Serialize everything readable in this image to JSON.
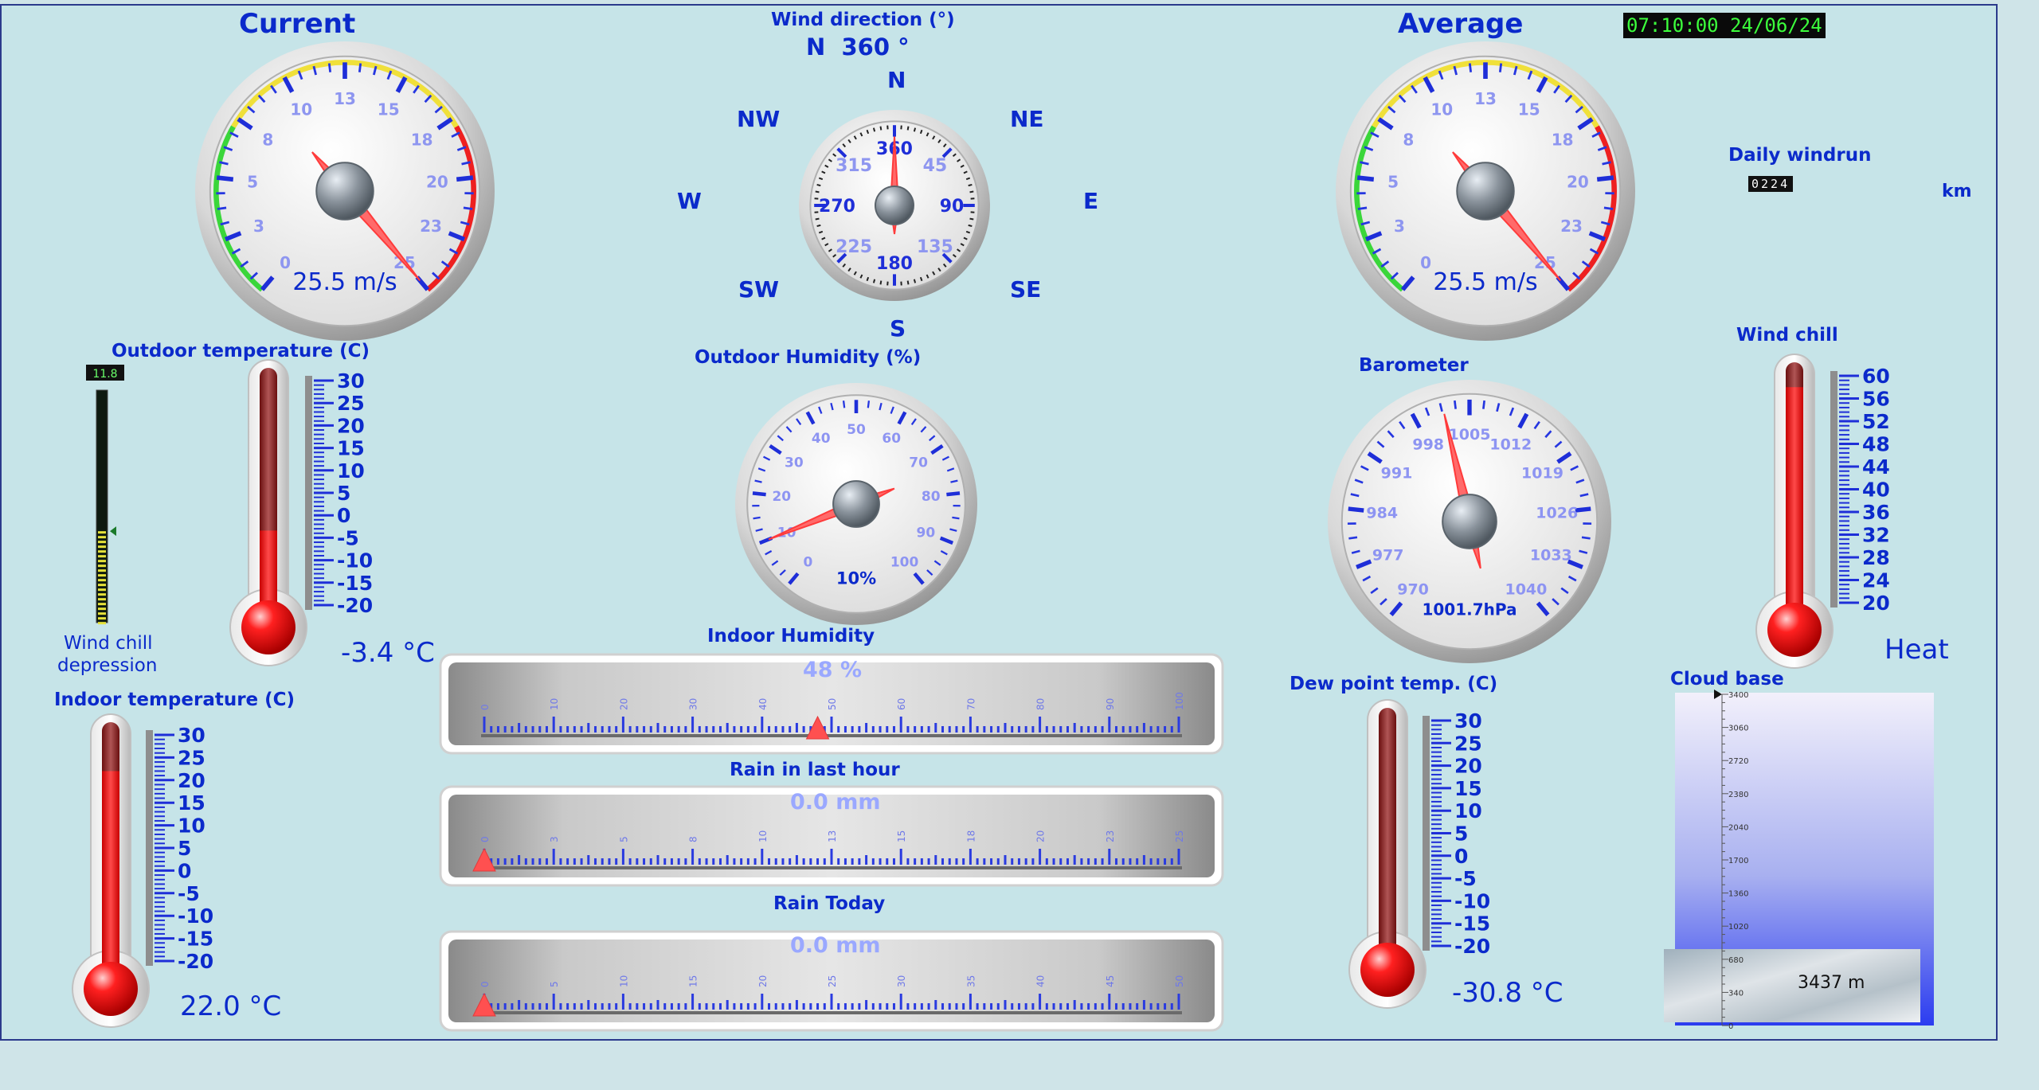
{
  "header": {
    "current_title": "Current",
    "average_title": "Average",
    "datetime": "07:10:00 24/06/24"
  },
  "wind_direction": {
    "title": "Wind direction (°)",
    "readout": "N  360 °",
    "value_deg": 360,
    "compass": {
      "n": "N",
      "ne": "NE",
      "e": "E",
      "se": "SE",
      "s": "S",
      "sw": "SW",
      "w": "W",
      "nw": "NW"
    },
    "dial_labels": [
      "360",
      "45",
      "90",
      "135",
      "180",
      "225",
      "270",
      "315"
    ]
  },
  "current_wind": {
    "value_text": "25.5 m/s",
    "value": 25.5,
    "ticks": [
      "0",
      "3",
      "5",
      "8",
      "10",
      "13",
      "15",
      "18",
      "20",
      "23",
      "25"
    ]
  },
  "average_wind": {
    "value_text": "25.5 m/s",
    "value": 25.5,
    "ticks": [
      "0",
      "3",
      "5",
      "8",
      "10",
      "13",
      "15",
      "18",
      "20",
      "23",
      "25"
    ]
  },
  "daily_windrun": {
    "title": "Daily windrun",
    "value": "0224",
    "unit": "km"
  },
  "outdoor_temp": {
    "title": "Outdoor temperature (C)",
    "value_text": "-3.4 °C",
    "value": -3.4,
    "scale": [
      "30",
      "25",
      "20",
      "15",
      "10",
      "5",
      "0",
      "-5",
      "-10",
      "-15",
      "-20"
    ]
  },
  "wind_chill_depression": {
    "title_line1": "Wind chill",
    "title_line2": "depression",
    "readout": "11.8",
    "value": 11.8
  },
  "indoor_temp": {
    "title": "Indoor temperature (C)",
    "value_text": "22.0 °C",
    "value": 22.0,
    "scale": [
      "30",
      "25",
      "20",
      "15",
      "10",
      "5",
      "0",
      "-5",
      "-10",
      "-15",
      "-20"
    ]
  },
  "outdoor_humidity": {
    "title": "Outdoor Humidity (%)",
    "value_text": "10%",
    "value": 10,
    "ticks": [
      "0",
      "10",
      "20",
      "30",
      "40",
      "50",
      "60",
      "70",
      "80",
      "90",
      "100"
    ]
  },
  "barometer": {
    "title": "Barometer",
    "value_text": "1001.7hPa",
    "value": 1001.7,
    "ticks": [
      "970",
      "977",
      "984",
      "991",
      "998",
      "1005",
      "1012",
      "1019",
      "1026",
      "1033",
      "1040"
    ]
  },
  "indoor_humidity": {
    "title": "Indoor Humidity",
    "value_text": "48 %",
    "value": 48,
    "scale": [
      "0",
      "10",
      "20",
      "30",
      "40",
      "50",
      "60",
      "70",
      "80",
      "90",
      "100"
    ]
  },
  "rain_last_hour": {
    "title": "Rain in last hour",
    "value_text": "0.0 mm",
    "value": 0,
    "scale": [
      "0",
      "3",
      "5",
      "8",
      "10",
      "13",
      "15",
      "18",
      "20",
      "23",
      "25"
    ]
  },
  "rain_today": {
    "title": "Rain Today",
    "value_text": "0.0 mm",
    "value": 0,
    "scale": [
      "0",
      "5",
      "10",
      "15",
      "20",
      "25",
      "30",
      "35",
      "40",
      "45",
      "50"
    ]
  },
  "dew_point": {
    "title": "Dew point temp. (C)",
    "value_text": "-30.8 °C",
    "value": -30.8,
    "scale": [
      "30",
      "25",
      "20",
      "15",
      "10",
      "5",
      "0",
      "-5",
      "-10",
      "-15",
      "-20"
    ]
  },
  "wind_chill": {
    "title": "Wind chill",
    "label": "Heat",
    "value": 58,
    "scale": [
      "60",
      "56",
      "52",
      "48",
      "44",
      "40",
      "36",
      "32",
      "28",
      "24",
      "20"
    ]
  },
  "cloud_base": {
    "title": "Cloud base",
    "value_text": "3437 m",
    "value": 3437,
    "scale": [
      "3400",
      "3060",
      "2720",
      "2380",
      "2040",
      "1700",
      "1360",
      "1020",
      "680",
      "340",
      "0"
    ]
  },
  "colors": {
    "label_blue": "#0b2acb",
    "needle_red": "#ff5a5a",
    "thermo_red": "#ff2b2b"
  }
}
